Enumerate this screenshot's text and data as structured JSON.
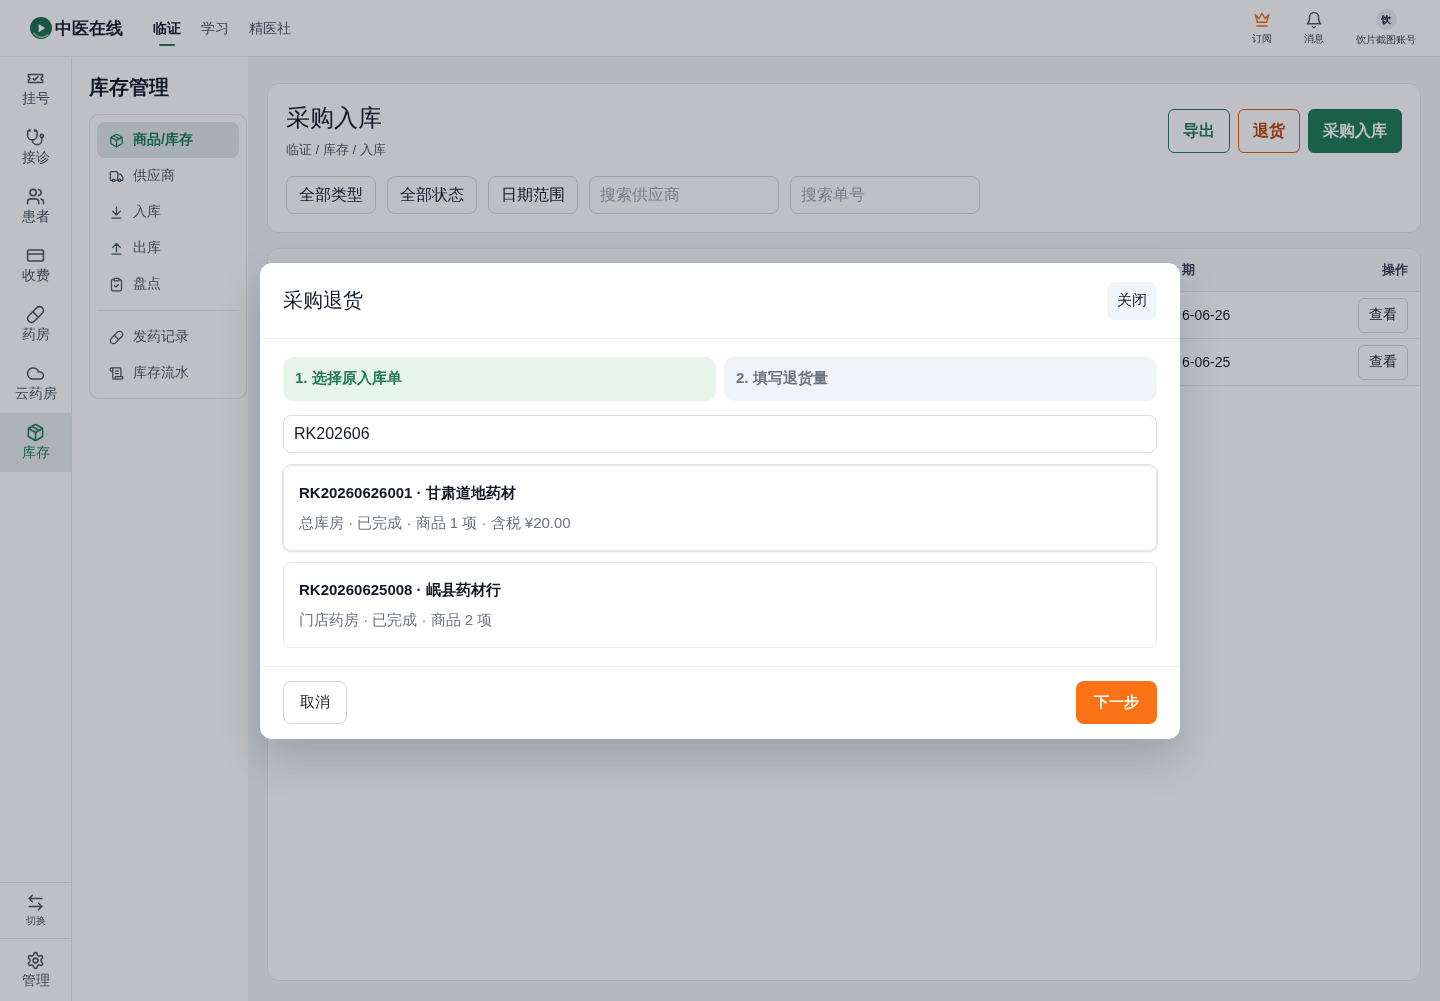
{
  "top_bar": {
    "logo": "中医在线",
    "nav": [
      {
        "label": "临证",
        "selected": true
      },
      {
        "label": "学习",
        "selected": false
      },
      {
        "label": "精医社",
        "selected": false
      }
    ],
    "actions": [
      {
        "kind": "subscribe",
        "label": "订阅"
      },
      {
        "kind": "messages",
        "label": "消息"
      }
    ],
    "account": {
      "avatar": "饮",
      "name": "饮片截图账号"
    }
  },
  "rail": {
    "items": [
      {
        "label": "挂号",
        "selected": false
      },
      {
        "label": "接诊",
        "selected": false
      },
      {
        "label": "患者",
        "selected": false
      },
      {
        "label": "收费",
        "selected": false
      },
      {
        "label": "药房",
        "selected": false
      },
      {
        "label": "云药房",
        "selected": false
      },
      {
        "label": "库存",
        "selected": true
      }
    ],
    "bottom": [
      {
        "label": "切换"
      },
      {
        "label": "管理"
      }
    ]
  },
  "sub_nav": {
    "title": "库存管理",
    "groups": [
      {
        "items": [
          {
            "label": "商品/库存",
            "selected": true
          },
          {
            "label": "供应商",
            "selected": false
          },
          {
            "label": "入库",
            "selected": false
          },
          {
            "label": "出库",
            "selected": false
          },
          {
            "label": "盘点",
            "selected": false
          }
        ]
      },
      {
        "items": [
          {
            "label": "发药记录",
            "selected": false
          },
          {
            "label": "库存流水",
            "selected": false
          }
        ]
      }
    ]
  },
  "page": {
    "title": "采购入库",
    "breadcrumb": "临证 / 库存 / 入库",
    "buttons": [
      {
        "kind": "outline",
        "label": "导出"
      },
      {
        "kind": "warning",
        "label": "退货"
      },
      {
        "kind": "primary",
        "label": "采购入库"
      }
    ],
    "filters": [
      {
        "kind": "select",
        "label": "全部类型"
      },
      {
        "kind": "select",
        "label": "全部状态"
      },
      {
        "kind": "select",
        "label": "日期范围"
      },
      {
        "kind": "search",
        "placeholder": "搜索供应商"
      },
      {
        "kind": "search",
        "placeholder": "搜索单号"
      }
    ]
  },
  "table": {
    "columns": [
      {
        "label": "期"
      },
      {
        "label": "操作"
      }
    ],
    "rows": [
      {
        "cells": [
          "6-06-26"
        ],
        "action": "查看"
      },
      {
        "cells": [
          "6-06-25"
        ],
        "action": "查看"
      }
    ]
  },
  "modal": {
    "title": "采购退货",
    "close": "关闭",
    "steps": [
      {
        "label": "1. 选择原入库单",
        "selected": true
      },
      {
        "label": "2. 填写退货量",
        "selected": false
      }
    ],
    "search": {
      "value": "RK202606"
    },
    "results": [
      {
        "title": "RK20260626001 · 甘肃道地药材",
        "detail": "总库房 · 已完成 · 商品 1 项 · 含税 ¥20.00",
        "selected": true
      },
      {
        "title": "RK20260625008 · 岷县药材行",
        "detail": "门店药房 · 已完成 · 商品 2 项",
        "selected": false
      }
    ],
    "cancel": "取消",
    "next": "下一步"
  }
}
